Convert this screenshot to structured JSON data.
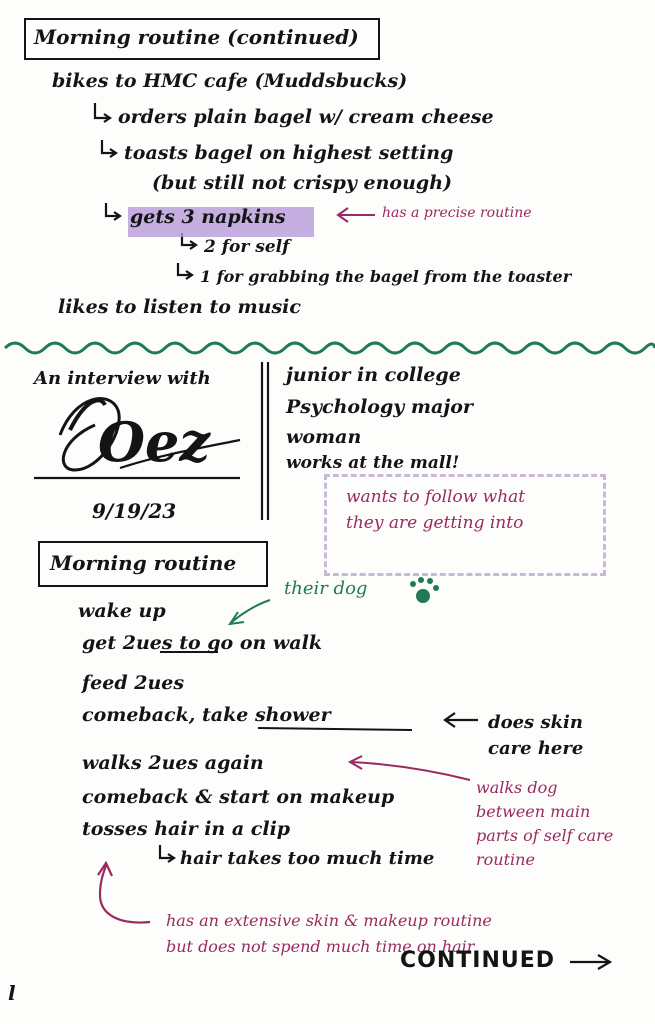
{
  "top_section": {
    "heading": "Morning routine (continued)",
    "bullets": [
      "bikes to HMC cafe (Muddsbucks)",
      "orders plain bagel w/ cream cheese",
      "toasts bagel on highest setting",
      "(but still not crispy enough)",
      "gets 3 napkins",
      "2 for self",
      "1 for grabbing the bagel from the toaster",
      "likes to listen to music"
    ],
    "annotation": "has a precise routine"
  },
  "interview": {
    "prefix": "An interview with",
    "name": "Oez",
    "date": "9/19/23",
    "facts": [
      "junior in college",
      "Psychology major",
      "woman",
      "works at the mall!"
    ],
    "goal_note": "wants to follow what they are getting into"
  },
  "bottom_section": {
    "heading": "Morning routine",
    "dog_note": "their dog",
    "bullets": [
      "wake up",
      "get 2ues to go on walk",
      "feed 2ues",
      "comeback, take shower",
      "walks 2ues again",
      "comeback & start on makeup",
      "tosses hair in a clip",
      "hair takes too much time"
    ],
    "skincare_note": "does skin care here",
    "walk_note": "walks dog between main parts of self care routine",
    "extensive_note": "has an extensive skin & makeup routine but does not spend much time on hair",
    "continued": "CONTINUED",
    "page_marker": "l"
  },
  "colors": {
    "ink": "#141414",
    "annotation": "#9a2a62",
    "green": "#1f7a58",
    "highlight": "#b79ad9"
  }
}
